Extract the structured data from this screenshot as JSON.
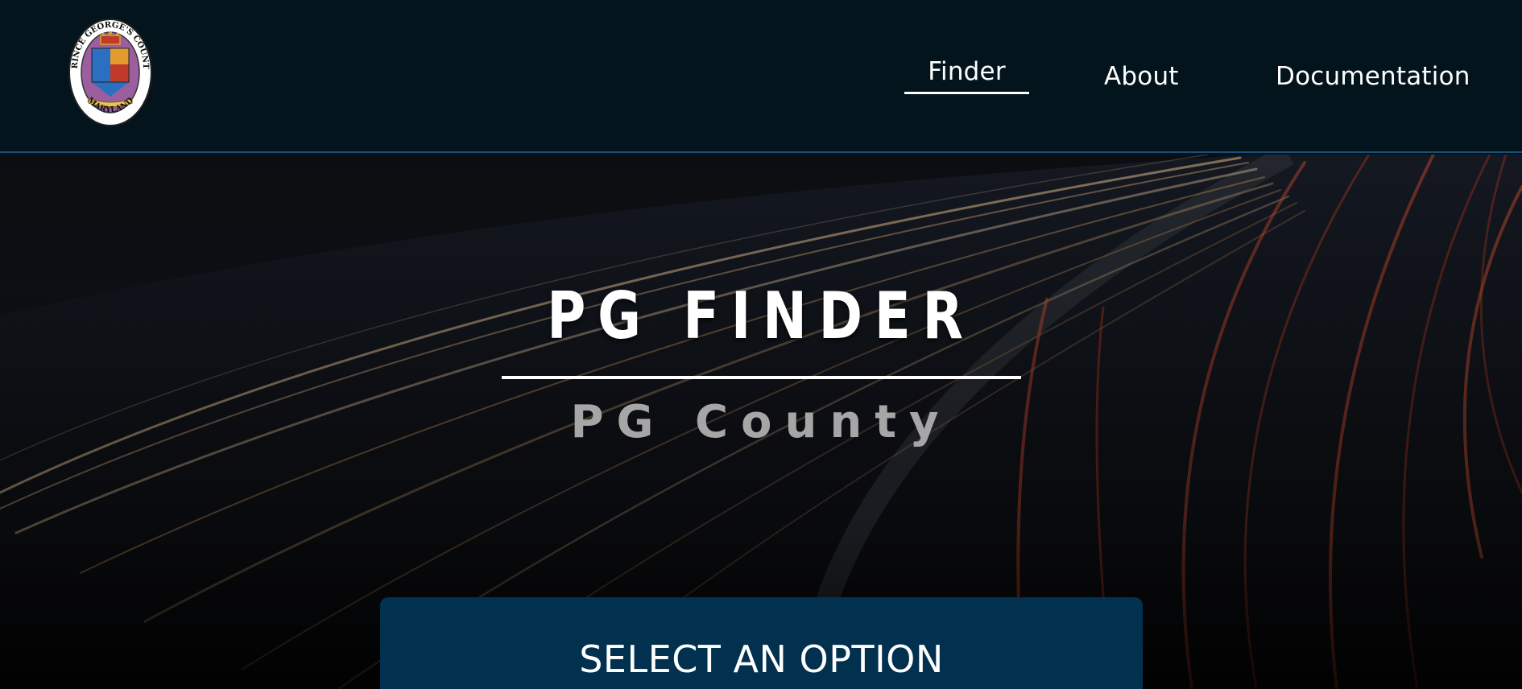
{
  "header": {
    "logo": {
      "top_text": "PRINCE GEORGE'S COUNTY",
      "bottom_text": "MARYLAND",
      "icon": "county-seal"
    },
    "nav": [
      {
        "label": "Finder",
        "active": true
      },
      {
        "label": "About",
        "active": false
      },
      {
        "label": "Documentation",
        "active": false
      }
    ],
    "border_color": "#1a4e7a"
  },
  "hero": {
    "title": "PG FINDER",
    "subtitle": "PG County",
    "background": "highway-light-trails",
    "select_button_label": "SELECT AN OPTION",
    "button_color": "#02304f"
  }
}
